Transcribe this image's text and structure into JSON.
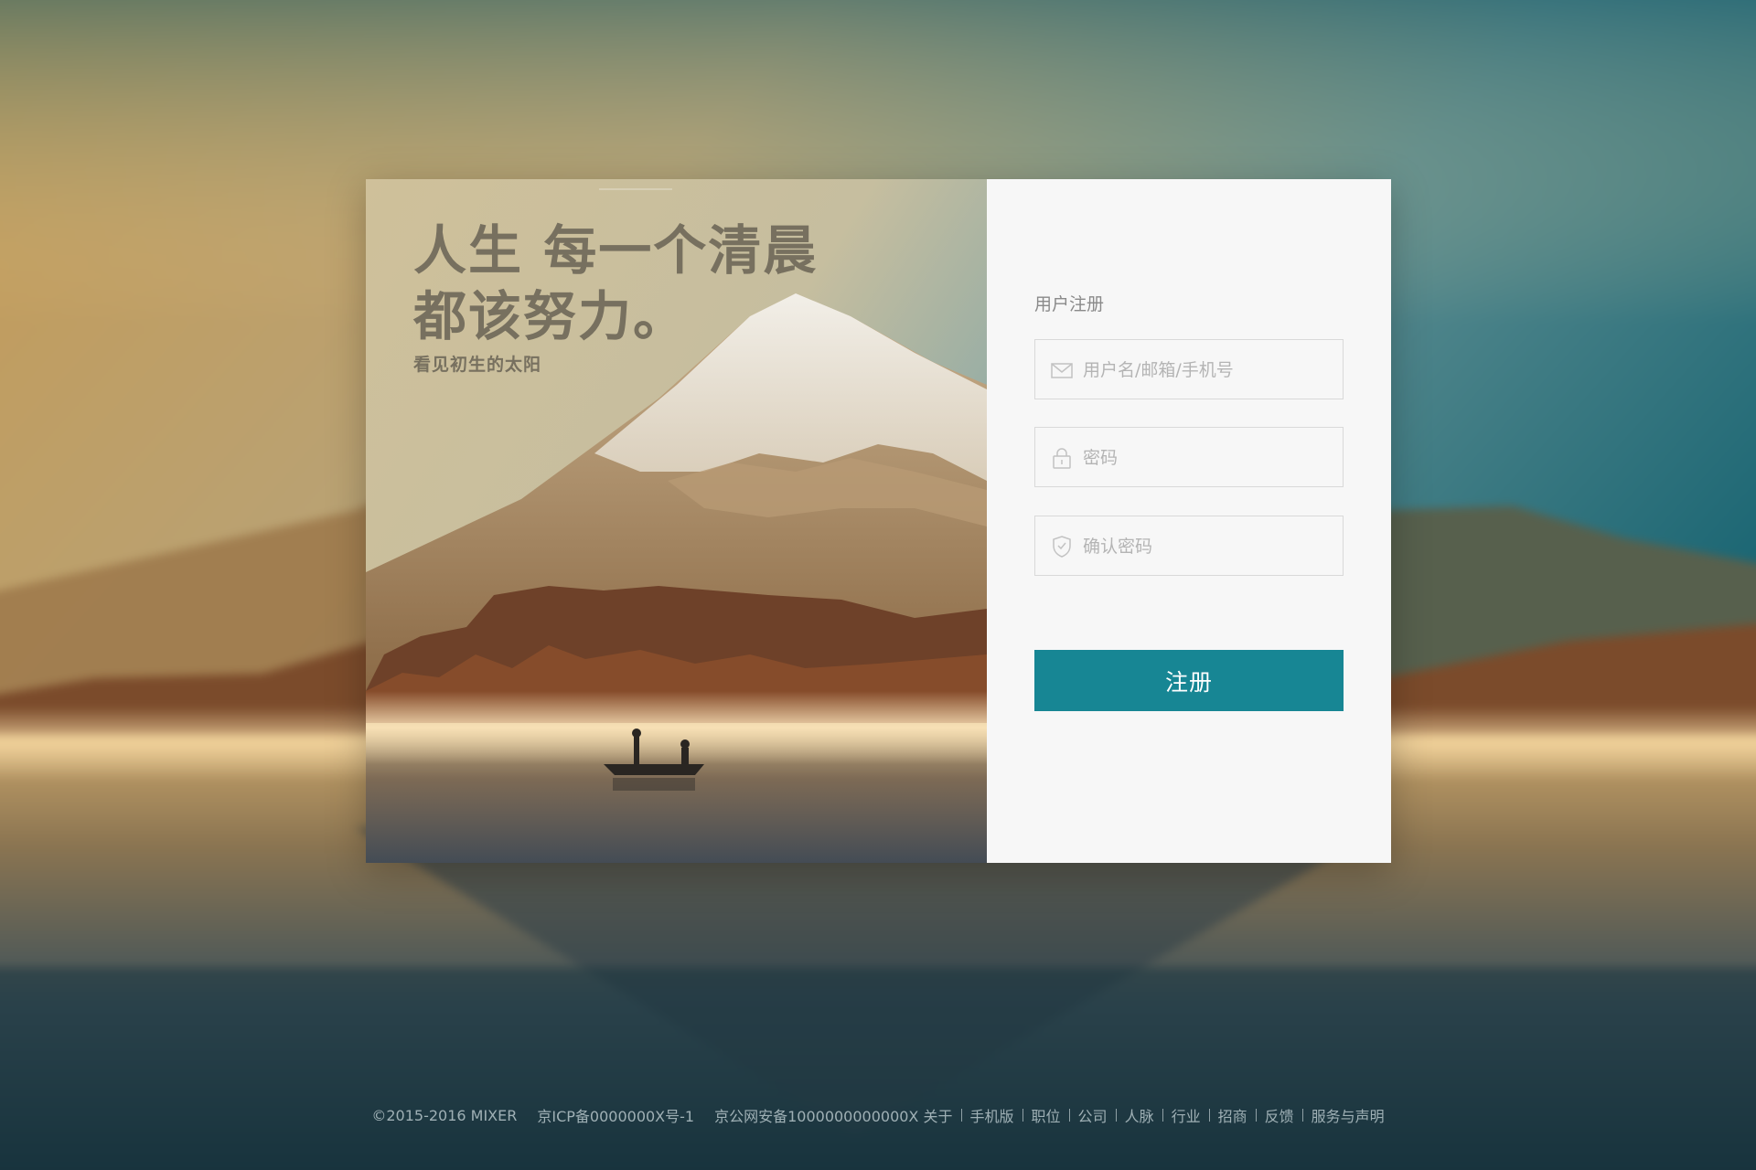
{
  "hero": {
    "headline_line1": "人生 每一个清晨",
    "headline_line2": "都该努力。",
    "subtitle": "看见初生的太阳"
  },
  "form": {
    "title": "用户注册",
    "username_placeholder": "用户名/邮箱/手机号",
    "username_icon": "mail-icon",
    "password_placeholder": "密码",
    "password_icon": "lock-icon",
    "confirm_placeholder": "确认密码",
    "confirm_icon": "shield-icon",
    "submit_label": "注册"
  },
  "footer": {
    "copyright": "©2015-2016 MIXER",
    "icp": "京ICP备0000000X号-1",
    "police": "京公网安备1000000000000X",
    "links": [
      "关于",
      "手机版",
      "职位",
      "公司",
      "人脉",
      "行业",
      "招商",
      "反馈",
      "服务与声明"
    ]
  },
  "colors": {
    "accent": "#178694",
    "form_bg": "#f7f7f7",
    "slogan": "#77705f"
  }
}
